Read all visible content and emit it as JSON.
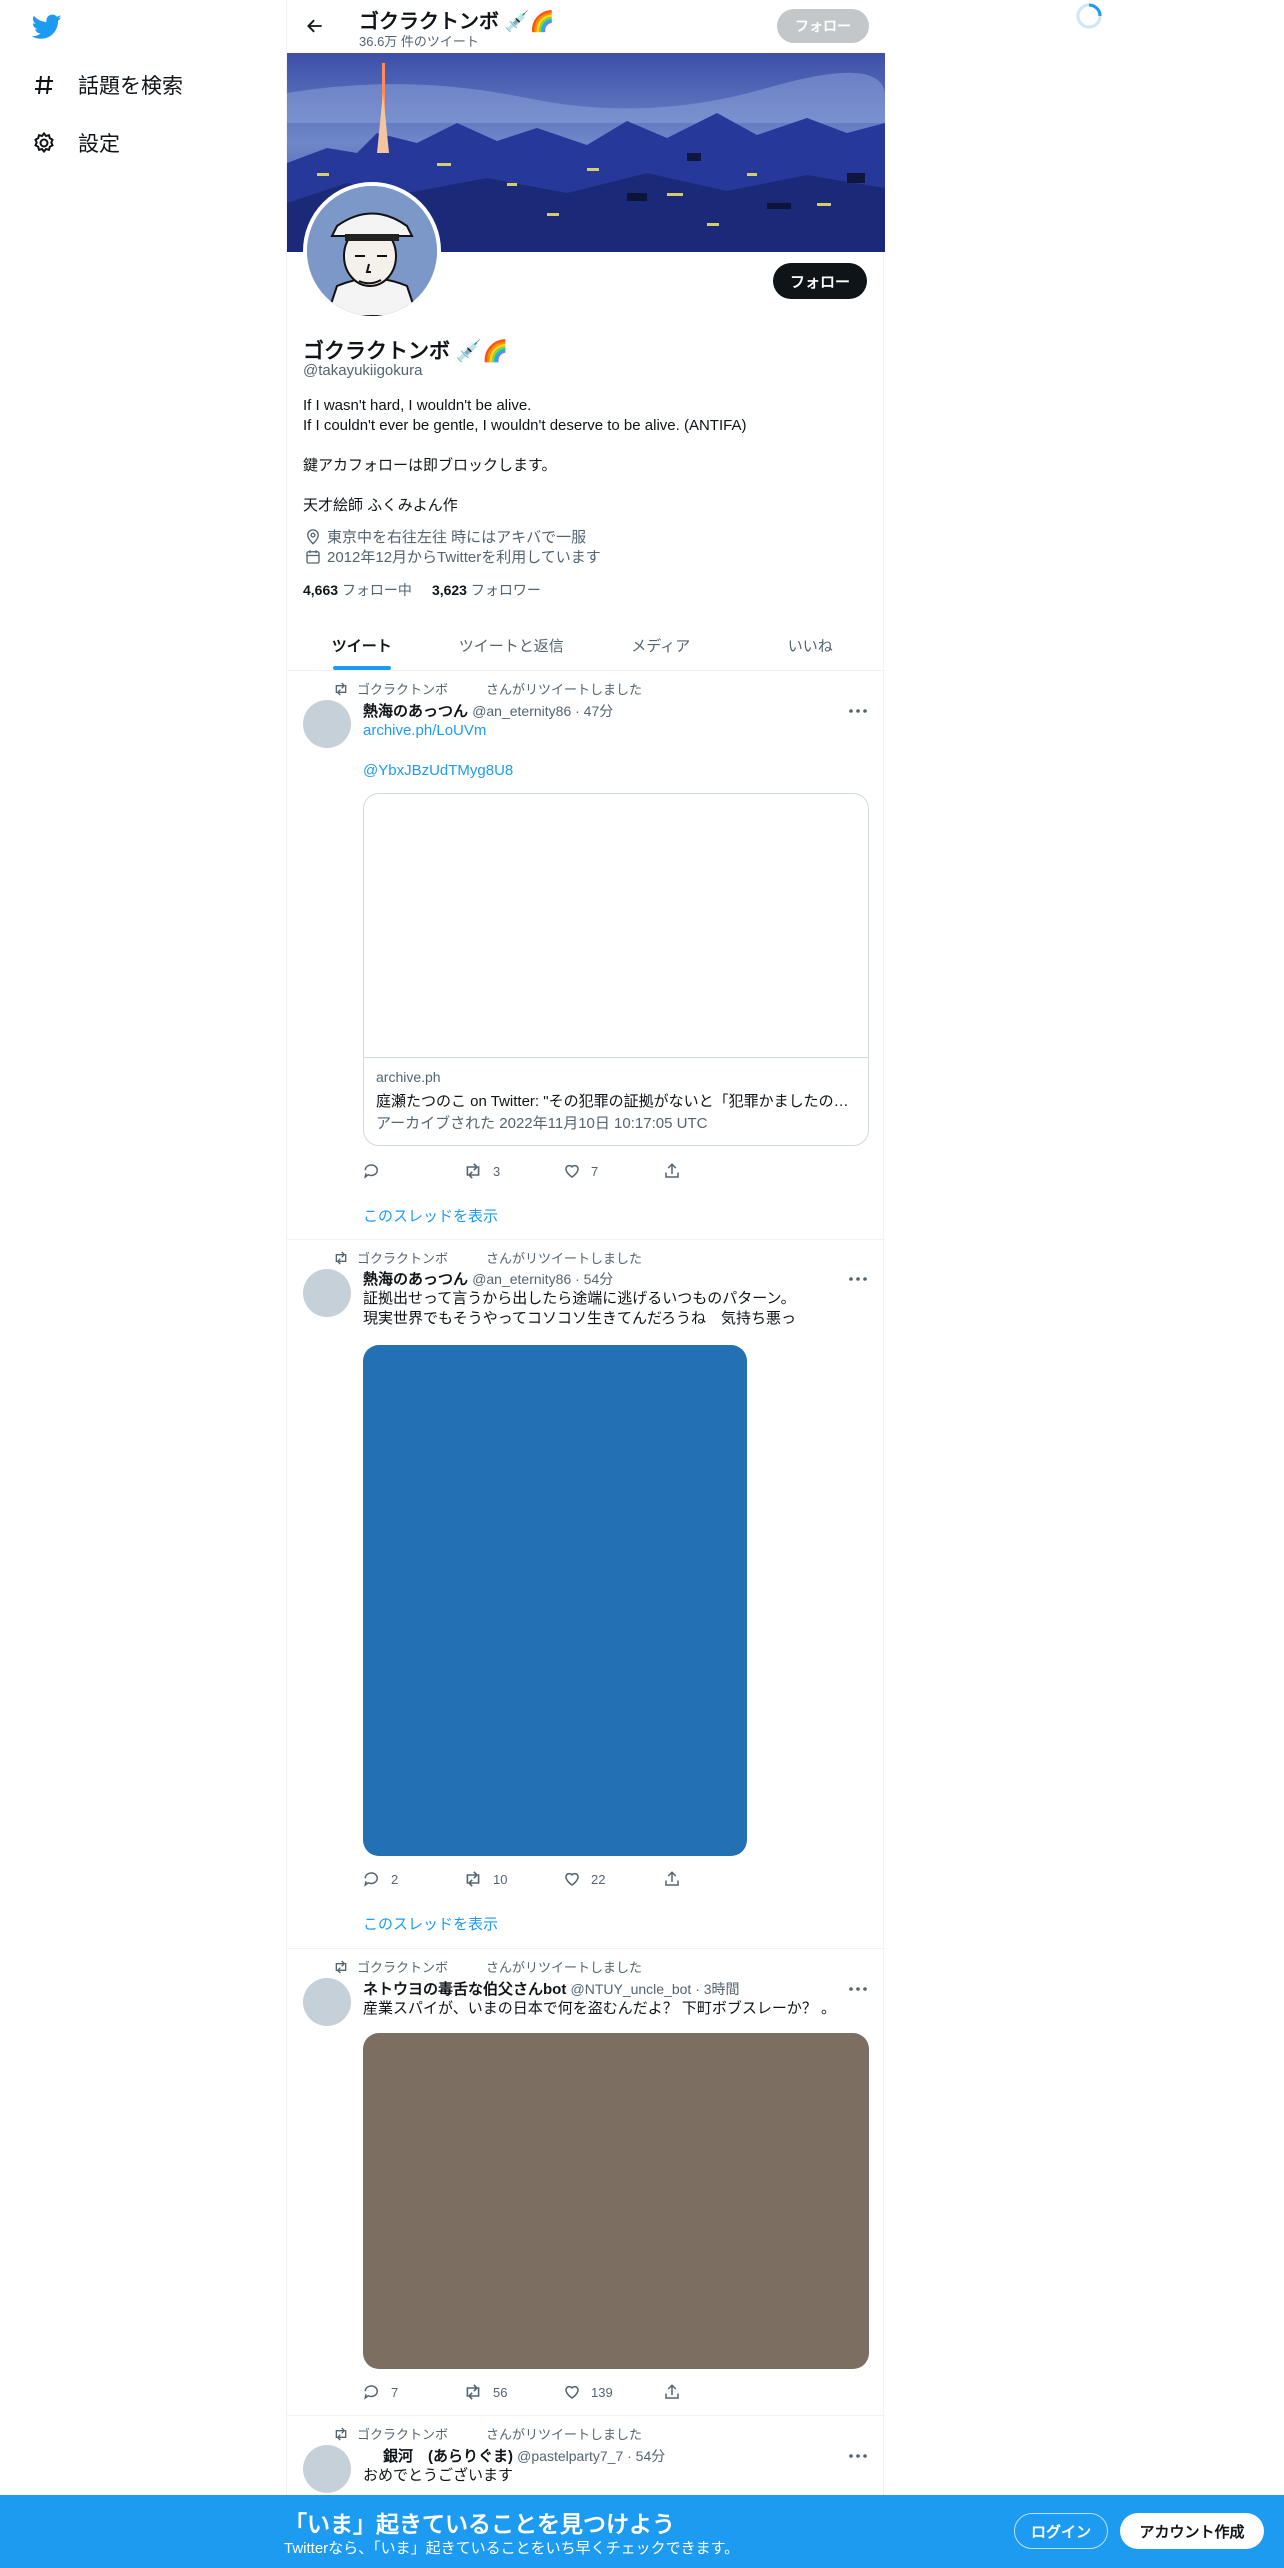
{
  "colors": {
    "accent": "#1d9bf0",
    "text": "#0f1419",
    "secondary": "#536471",
    "media1": "#2470b4",
    "media2": "#7c6e61"
  },
  "nav": {
    "logo": "twitter-bird-icon",
    "explore": "話題を検索",
    "settings": "設定"
  },
  "header": {
    "name": "ゴクラクトンボ",
    "name_emoji": "💉🌈",
    "tweet_count": "36.6万 件のツイート",
    "follow": "フォロー"
  },
  "profile": {
    "name": "ゴクラクトンボ",
    "name_emoji": "💉🌈",
    "handle": "@takayukiigokura",
    "follow": "フォロー",
    "bio": [
      "If I wasn't hard, I wouldn't be alive.",
      "If I couldn't ever be gentle, I wouldn't deserve to be alive. (ANTIFA)",
      "",
      "鍵アカフォローは即ブロックします。",
      "",
      "天才絵師 ふくみよん作"
    ],
    "location": "東京中を右往左往 時にはアキバで一服",
    "joined": "2012年12月からTwitterを利用しています",
    "following_count": "4,663",
    "following_label": "フォロー中",
    "followers_count": "3,623",
    "followers_label": "フォロワー"
  },
  "tabs": [
    "ツイート",
    "ツイートと返信",
    "メディア",
    "いいね"
  ],
  "tweets": [
    {
      "retweeter": "ゴクラクトンボ",
      "rt_label": "さんがリツイートしました",
      "display_name": "熱海のあっつん",
      "handle_time": "@an_eternity86 · 47分",
      "link1": "archive.ph/LoUVm",
      "link2": "@YbxJBzUdTMyg8U8",
      "card": {
        "domain": "archive.ph",
        "title": "庭瀬たつのこ on Twitter: \"その犯罪の証拠がないと「犯罪かましたの…",
        "desc": "アーカイブされた 2022年11月10日 10:17:05 UTC"
      },
      "replies": "",
      "retweets": "3",
      "likes": "7",
      "thread": "このスレッドを表示"
    },
    {
      "retweeter": "ゴクラクトンボ",
      "rt_label": "さんがリツイートしました",
      "display_name": "熱海のあっつん",
      "handle_time": "@an_eternity86 · 54分",
      "text1": "証拠出せって言うから出したら途端に逃げるいつものパターン。",
      "text2": "現実世界でもそうやってコソコソ生きてんだろうね　気持ち悪っ",
      "replies": "2",
      "retweets": "10",
      "likes": "22",
      "thread": "このスレッドを表示"
    },
    {
      "retweeter": "ゴクラクトンボ",
      "rt_label": "さんがリツイートしました",
      "display_name": "ネトウヨの毒舌な伯父さんbot",
      "handle_time": "@NTUY_uncle_bot · 3時間",
      "text1": "産業スパイが、いまの日本で何を盗むんだよ？ 下町ボブスレーか？ 。",
      "replies": "7",
      "retweets": "56",
      "likes": "139"
    },
    {
      "retweeter": "ゴクラクトンボ",
      "rt_label": "さんがリツイートしました",
      "display_name": "銀河　(あらりぐま)",
      "handle_time": "@pastelparty7_7 · 54分",
      "text1": "おめでとうございます"
    }
  ],
  "bottom": {
    "title": "「いま」起きていることを見つけよう",
    "subtitle": "Twitterなら、「いま」起きていることをいち早くチェックできます。",
    "login": "ログイン",
    "signup": "アカウント作成"
  }
}
